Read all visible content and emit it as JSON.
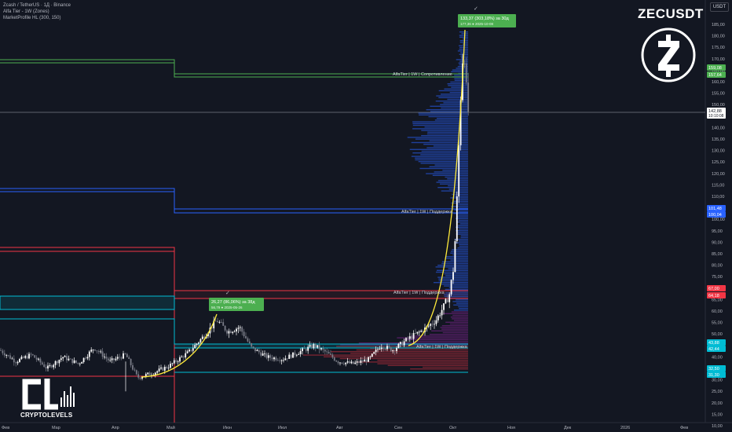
{
  "header": {
    "symbol_line": "Zcash / TetherUS · 1Д · Binance",
    "indicator_1": "Alfa Tier - 1W (Zones)",
    "indicator_2": "MarketProfile HL (300, 150)"
  },
  "brand": {
    "ticker": "ZECUSDT",
    "logo_text": "CRYPTOLEVELS"
  },
  "currency_button": "USDT",
  "x_axis_labels": [
    "Фев",
    "Мар",
    "Апр",
    "Май",
    "Июн",
    "Июл",
    "Авг",
    "Сен",
    "Окт",
    "Ноя",
    "Дек",
    "2026",
    "Фев"
  ],
  "y_axis_labels": [
    "185,00",
    "180,00",
    "175,00",
    "170,00",
    "165,00",
    "160,00",
    "155,00",
    "150,00",
    "145,00",
    "140,00",
    "135,00",
    "130,00",
    "125,00",
    "120,00",
    "115,00",
    "110,00",
    "105,00",
    "100,00",
    "95,00",
    "90,00",
    "85,00",
    "80,00",
    "75,00",
    "70,00",
    "65,00",
    "60,00",
    "55,00",
    "50,00",
    "45,00",
    "40,00",
    "35,00",
    "30,00",
    "25,00",
    "20,00",
    "15,00",
    "10,00"
  ],
  "price_tags": [
    {
      "value": "159,08",
      "sub": "",
      "color": "#4caf50"
    },
    {
      "value": "157,64",
      "sub": "",
      "color": "#4caf50"
    },
    {
      "value": "142,88",
      "sub": "10:10:08",
      "color": "#ffffff"
    },
    {
      "value": "101,48",
      "sub": "",
      "color": "#2962ff"
    },
    {
      "value": "100,04",
      "sub": "",
      "color": "#2962ff"
    },
    {
      "value": "67,00",
      "sub": "",
      "color": "#f23645"
    },
    {
      "value": "64,18",
      "sub": "",
      "color": "#f23645"
    },
    {
      "value": "43,88",
      "sub": "",
      "color": "#00bcd4"
    },
    {
      "value": "42,44",
      "sub": "",
      "color": "#00bcd4"
    },
    {
      "value": "32,50",
      "sub": "",
      "color": "#00bcd4"
    },
    {
      "value": "31,30",
      "sub": "",
      "color": "#00bcd4"
    }
  ],
  "zone_labels": {
    "resistance": "AlfaTier | 1W | Сопротивление",
    "support_1": "AlfaTier | 1W | Поддержка",
    "support_2": "AlfaTier | 1W | Поддержка",
    "support_3": "AlfaTier | 1W | Поддержка"
  },
  "callouts": [
    {
      "line1": "133,37 (303,18%) за 30д",
      "line2": "177,36 ● 2025-10-08"
    },
    {
      "line1": "26,27 (86,06%) за 38д",
      "line2": "56,79 ● 2025-05-26"
    }
  ],
  "colors": {
    "background": "#131722",
    "resistance": "#4caf50",
    "support_blue": "#2962ff",
    "support_red": "#f23645",
    "support_cyan": "#00bcd4",
    "curve": "#ffeb3b",
    "callout": "#4caf50"
  }
}
